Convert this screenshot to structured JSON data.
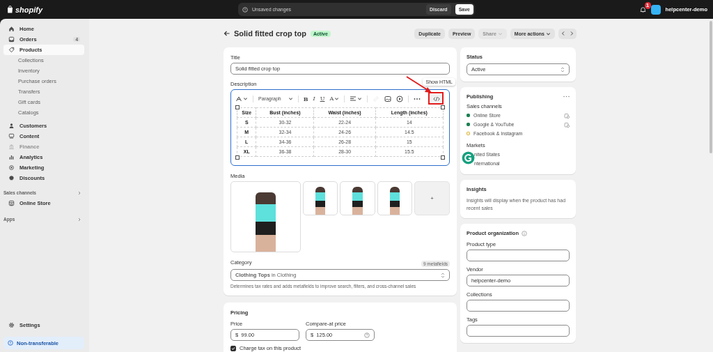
{
  "topbar": {
    "logo": "shopify",
    "notice": "Unsaved changes",
    "discard": "Discard",
    "save": "Save",
    "notification_count": "1",
    "store": "helpcenter-demo"
  },
  "sidebar": {
    "items": [
      {
        "kind": "home",
        "label": "Home",
        "selected": false,
        "disabled": false
      },
      {
        "kind": "orders",
        "label": "Orders",
        "badge": "4",
        "selected": false,
        "disabled": false
      },
      {
        "kind": "products",
        "label": "Products",
        "selected": true,
        "disabled": false,
        "children": [
          {
            "label": "Collections",
            "selected": false
          },
          {
            "label": "Inventory",
            "selected": false
          },
          {
            "label": "Purchase orders",
            "selected": false
          },
          {
            "label": "Transfers",
            "selected": false
          },
          {
            "label": "Gift cards",
            "selected": false
          },
          {
            "label": "Catalogs",
            "selected": false
          }
        ]
      },
      {
        "kind": "customers",
        "label": "Customers",
        "selected": false,
        "disabled": false
      },
      {
        "kind": "content",
        "label": "Content",
        "selected": false,
        "disabled": false
      },
      {
        "kind": "finance",
        "label": "Finance",
        "selected": false,
        "disabled": true
      },
      {
        "kind": "analytics",
        "label": "Analytics",
        "selected": false,
        "disabled": false
      },
      {
        "kind": "marketing",
        "label": "Marketing",
        "selected": false,
        "disabled": false
      },
      {
        "kind": "discounts",
        "label": "Discounts",
        "selected": false,
        "disabled": false
      }
    ],
    "sales_channels": {
      "title": "Sales channels",
      "items": [
        {
          "label": "Online Store",
          "selected": false
        }
      ]
    },
    "apps": {
      "title": "Apps"
    },
    "settings": "Settings",
    "plan_notice": "Non-transferable"
  },
  "header": {
    "title": "Solid fitted crop top",
    "status": "Active",
    "actions": [
      {
        "label": "Duplicate",
        "disabled": false,
        "menu": false
      },
      {
        "label": "Preview",
        "disabled": false,
        "menu": false
      },
      {
        "label": "Share",
        "disabled": true,
        "menu": true
      },
      {
        "label": "More actions",
        "disabled": false,
        "menu": true
      }
    ]
  },
  "product": {
    "title_label": "Title",
    "title_value": "Solid fitted crop top",
    "description_label": "Description",
    "toolbar": {
      "style": "Paragraph",
      "marks": [
        {
          "label": "B",
          "kind": "bold"
        },
        {
          "label": "I",
          "kind": "italic"
        },
        {
          "label": "U",
          "kind": "underline"
        },
        {
          "label": "A",
          "kind": "color"
        }
      ],
      "tools": [
        {
          "kind": "align",
          "disabled": false
        },
        {
          "kind": "link",
          "disabled": true
        },
        {
          "kind": "image",
          "disabled": false
        },
        {
          "kind": "video",
          "disabled": false
        },
        {
          "kind": "more",
          "disabled": false
        },
        {
          "kind": "html",
          "disabled": false
        }
      ],
      "tooltip": "Show HTML"
    },
    "size_table": {
      "columns": [
        "Size",
        "Bust (inches)",
        "Waist (inches)",
        "Length (inches)"
      ],
      "rows": [
        [
          "S",
          "30-32",
          "22-24",
          "14"
        ],
        [
          "M",
          "32-34",
          "24-26",
          "14.5"
        ],
        [
          "L",
          "34-36",
          "26-28",
          "15"
        ],
        [
          "XL",
          "36-38",
          "28-30",
          "15.5"
        ]
      ]
    },
    "media": {
      "label": "Media",
      "photos": [
        {
          "kind": "main"
        },
        {
          "kind": "thumbnail"
        },
        {
          "kind": "thumbnail"
        },
        {
          "kind": "thumbnail"
        }
      ],
      "add": "+"
    },
    "category": {
      "label": "Category",
      "badge": "9 metafields",
      "value": "**Clothing Tops** in Clothing",
      "help": "Determines tax rates and adds metafields to improve search, filters, and cross-channel sales"
    },
    "pricing": {
      "title": "Pricing",
      "price_label": "Price",
      "currency": "$",
      "price": "99.00",
      "compare_label": "Compare-at price",
      "compare_currency": "$",
      "compare_price": "125.00",
      "tax_label": "Charge tax on this product",
      "tax_checked": true
    }
  },
  "aside": {
    "status": {
      "label": "Status",
      "value": "Active"
    },
    "publishing": {
      "title": "Publishing",
      "channels_label": "Sales channels",
      "channels": [
        {
          "label": "Online Store",
          "color": "#1a7f52",
          "published": true
        },
        {
          "label": "Google & YouTube",
          "color": "#1a7f52",
          "published": true
        },
        {
          "label": "Facebook & Instagram",
          "color": "#d6a81c",
          "published": false
        }
      ],
      "markets_label": "Markets",
      "markets": [
        "nited States",
        "nternational"
      ]
    },
    "insights": {
      "title": "Insights",
      "text": "Insights will display when the product has had recent sales"
    },
    "organization": {
      "title": "Product organization",
      "fields": [
        {
          "label": "Product type"
        },
        {
          "label": "Vendor",
          "value": "helpcenter-demo"
        },
        {
          "label": "Collections"
        },
        {
          "label": "Tags"
        }
      ]
    }
  }
}
